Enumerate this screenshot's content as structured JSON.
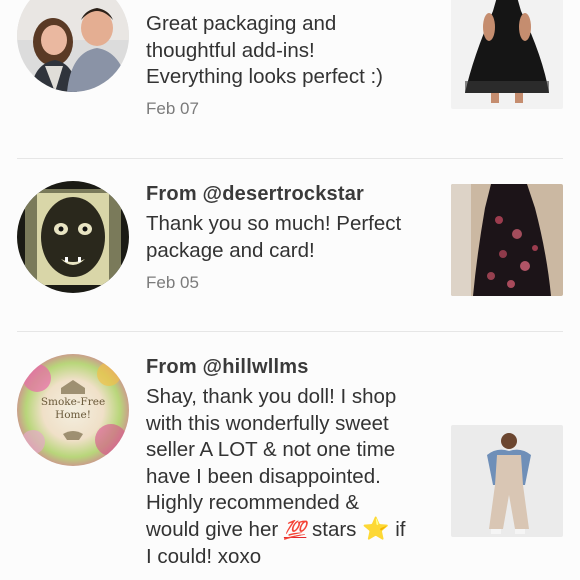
{
  "reviews": [
    {
      "from": "",
      "message_lines": [
        "Great packaging and",
        "thoughtful add-ins!",
        "Everything looks perfect :)"
      ],
      "date": "Feb 07",
      "avatar_icon": "couple-photo",
      "thumb_icon": "black-dress-photo"
    },
    {
      "from": "From @desertrockstar",
      "message_lines": [
        "Thank you so much! Perfect",
        "package and card!"
      ],
      "date": "Feb 05",
      "avatar_icon": "face-filter-photo",
      "thumb_icon": "floral-dress-photo"
    },
    {
      "from": "From @hillwllms",
      "message_lines": [
        "Shay, thank you doll! I shop",
        "with this wonderfully sweet",
        "seller A LOT & not one time",
        "have I been disappointed.",
        "Highly recommended &"
      ],
      "message_line6_before": "would give her ",
      "message_line6_emoji1": "💯",
      "message_line6_mid": " stars ",
      "message_line6_emoji2": "⭐",
      "message_line6_after": " if",
      "message_line7": "I could! xoxo",
      "avatar_text_lines": [
        "Smoke-Free",
        "Home!"
      ],
      "avatar_icon": "smoke-free-home-badge",
      "thumb_icon": "jumpsuit-model-photo"
    }
  ]
}
